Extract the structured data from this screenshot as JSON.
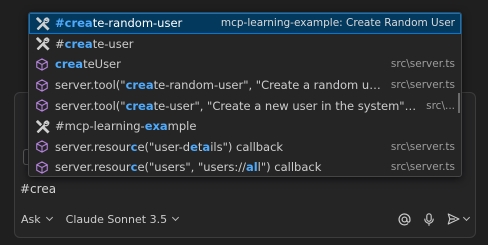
{
  "chat": {
    "input_value": "#crea",
    "mode_label": "Ask",
    "model_label": "Claude Sonnet 3.5"
  },
  "suggestions": {
    "items": [
      {
        "icon": "tools-icon",
        "kind": "tool",
        "segments": [
          [
            "#crea",
            true
          ],
          [
            "te-random-user",
            false
          ]
        ],
        "detail": "mcp-learning-example: Create Random User",
        "selected": true
      },
      {
        "icon": "tools-icon",
        "kind": "tool",
        "segments": [
          [
            "#",
            false
          ],
          [
            "crea",
            true
          ],
          [
            "te-user",
            false
          ]
        ],
        "detail": "",
        "selected": false
      },
      {
        "icon": "symbol-cube-icon",
        "kind": "symbol",
        "segments": [
          [
            "crea",
            true
          ],
          [
            "teUser",
            false
          ]
        ],
        "detail": "src\\server.ts",
        "selected": false
      },
      {
        "icon": "symbol-cube-icon",
        "kind": "symbol",
        "segments": [
          [
            "server.tool(\"",
            false
          ],
          [
            "crea",
            true
          ],
          [
            "te-random-user\", \"Create a random user with fak...",
            false
          ]
        ],
        "detail": "src\\server.ts",
        "selected": false
      },
      {
        "icon": "symbol-cube-icon",
        "kind": "symbol",
        "segments": [
          [
            "server.tool(\"",
            false
          ],
          [
            "crea",
            true
          ],
          [
            "te-user\", \"Create a new user in the system\") ...",
            false
          ]
        ],
        "detail": "src\\...",
        "selected": false
      },
      {
        "icon": "tools-icon",
        "kind": "tool",
        "segments": [
          [
            "#",
            false
          ],
          [
            "mc",
            false
          ],
          [
            "p-learning-",
            false
          ],
          [
            "exa",
            true
          ],
          [
            "mple",
            false
          ]
        ],
        "detail": "",
        "selected": false
      },
      {
        "icon": "symbol-cube-icon",
        "kind": "symbol",
        "segments": [
          [
            "server.resour",
            false
          ],
          [
            "c",
            true
          ],
          [
            "e(\"user-d",
            false
          ],
          [
            "e",
            true
          ],
          [
            "t",
            false
          ],
          [
            "a",
            true
          ],
          [
            "ils\") callback",
            false
          ]
        ],
        "detail": "src\\server.ts",
        "selected": false
      },
      {
        "icon": "symbol-cube-icon",
        "kind": "symbol",
        "segments": [
          [
            "server.resour",
            false
          ],
          [
            "c",
            true
          ],
          [
            "e(\"user",
            false
          ],
          [
            "s",
            false
          ],
          [
            "\", \"users://",
            false
          ],
          [
            "al",
            true
          ],
          [
            "l\") callback",
            false
          ]
        ],
        "detail": "src\\server.ts",
        "selected": false
      }
    ]
  },
  "colors": {
    "match": "#4daafc",
    "selection_bg": "#04395e",
    "selection_border": "#0078d4",
    "cube_icon": "#b180d7"
  }
}
